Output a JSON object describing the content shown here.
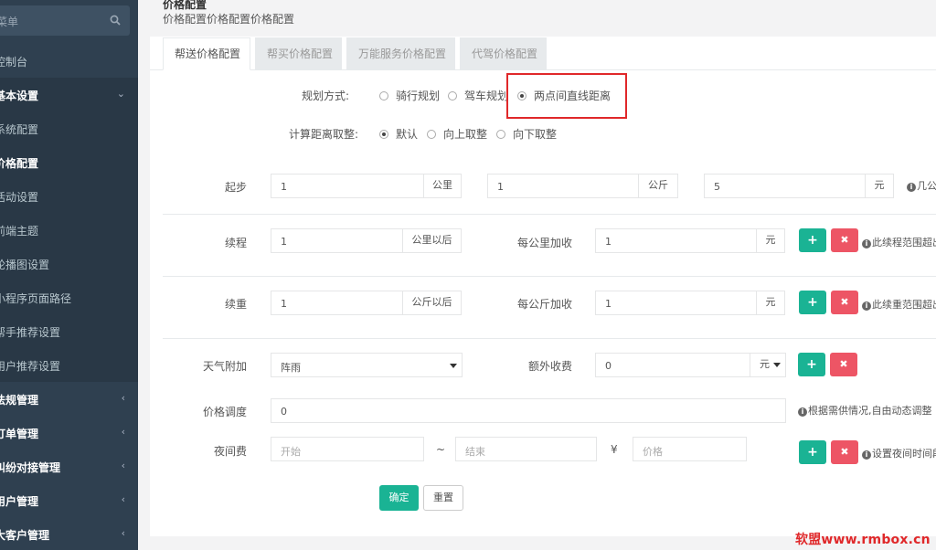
{
  "sidebar": {
    "search_placeholder": "菜单",
    "items": [
      {
        "label": "控制台"
      },
      {
        "label": "基本设置"
      },
      {
        "label": "系统配置"
      },
      {
        "label": "价格配置"
      },
      {
        "label": "活动设置"
      },
      {
        "label": "前端主题"
      },
      {
        "label": "轮播图设置"
      },
      {
        "label": "小程序页面路径"
      },
      {
        "label": "帮手推荐设置"
      },
      {
        "label": "用户推荐设置"
      },
      {
        "label": "法规管理"
      },
      {
        "label": "订单管理"
      },
      {
        "label": "纠纷对接管理"
      },
      {
        "label": "用户管理"
      },
      {
        "label": "大客户管理"
      }
    ]
  },
  "header": {
    "title": "价格配置",
    "breadcrumb": "价格配置价格配置价格配置"
  },
  "tabs": [
    {
      "label": "帮送价格配置"
    },
    {
      "label": "帮买价格配置"
    },
    {
      "label": "万能服务价格配置"
    },
    {
      "label": "代驾价格配置"
    }
  ],
  "form": {
    "plan_mode": {
      "label": "规划方式:",
      "options": [
        "骑行规划",
        "驾车规划",
        "两点间直线距离"
      ],
      "selected": "两点间直线距离"
    },
    "rounding": {
      "label": "计算距离取整:",
      "options": [
        "默认",
        "向上取整",
        "向下取整"
      ],
      "selected": "默认"
    },
    "start": {
      "label": "起步",
      "distance_value": "1",
      "distance_unit": "公里",
      "weight_value": "1",
      "weight_unit": "公斤",
      "price_value": "5",
      "price_unit": "元",
      "hint": "几公"
    },
    "extra_distance": {
      "label": "续程",
      "value": "1",
      "unit": "公里以后",
      "add_label": "每公里加收",
      "add_value": "1",
      "add_unit": "元",
      "hint": "此续程范围超出"
    },
    "extra_weight": {
      "label": "续重",
      "value": "1",
      "unit": "公斤以后",
      "add_label": "每公斤加收",
      "add_value": "1",
      "add_unit": "元",
      "hint": "此续重范围超出"
    },
    "weather": {
      "label": "天气附加",
      "selected": "阵雨",
      "extra_label": "额外收费",
      "extra_value": "0",
      "extra_unit": "元"
    },
    "price_adjust": {
      "label": "价格调度",
      "value": "0",
      "hint": "根据需供情况,自由动态调整"
    },
    "night": {
      "label": "夜间费",
      "start_placeholder": "开始",
      "separator": "~",
      "end_placeholder": "结束",
      "currency": "¥",
      "price_placeholder": "价格",
      "hint": "设置夜间时间段"
    },
    "buttons": {
      "plus": "+",
      "delete": "✖",
      "confirm": "确定",
      "reset": "重置"
    }
  },
  "watermark": "软盟www.rmbox.cn",
  "colors": {
    "sidebar_bg": "#2f4050",
    "accent_green": "#1ab394",
    "danger_red": "#ed5565",
    "highlight_box": "#e0282a"
  }
}
